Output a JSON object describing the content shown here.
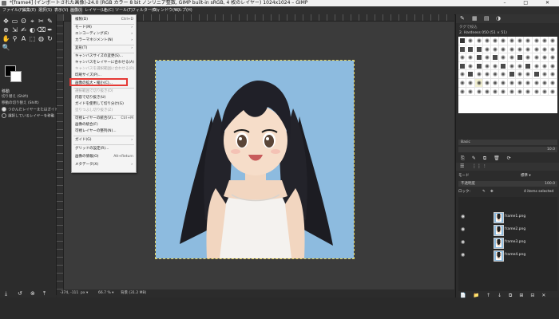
{
  "window": {
    "title": "*[frame4] (インポートされた画像)-24.0 (RGB カラー 8 bit ノンリニア整数, GIMP built-in sRGB, 4 枚のレイヤー) 1024x1024 – GIMP",
    "controls": "– □ ✕"
  },
  "menubar": {
    "items": [
      "ファイル(F)",
      "編集(E)",
      "選択(S)",
      "表示(V)",
      "画像(I)",
      "レイヤー(L)",
      "色(C)",
      "ツール(T)",
      "フィルター(R)",
      "ウィンドウ(W)",
      "ヘルプ(H)"
    ]
  },
  "image_menu": {
    "items": [
      {
        "label": "複製(D)",
        "shortcut": "Ctrl+D"
      },
      {
        "label": "モード(M)",
        "arrow": "›"
      },
      {
        "label": "エンコーディング(E)",
        "arrow": "›"
      },
      {
        "label": "カラーマネジメント(N)",
        "arrow": "›"
      },
      {
        "label": "変形(T)",
        "arrow": "›"
      },
      {
        "label": "キャンバスサイズの変更(S)..."
      },
      {
        "label": "キャンバスをレイヤーに合わせる(A)"
      },
      {
        "label": "キャンバスを選択範囲に合わせる(R)",
        "disabled": true
      },
      {
        "label": "印刷サイズ(P)..."
      },
      {
        "label": "画像の拡大・縮小(C)..."
      },
      {
        "label": "選択範囲で切り抜き(O)",
        "disabled": true
      },
      {
        "label": "内容で切り抜き(U)"
      },
      {
        "label": "ガイドを使用して切り分け(G)"
      },
      {
        "label": "塗りつぶし切り抜き(Z)",
        "disabled": true
      },
      {
        "label": "可視レイヤーの統合(V)...",
        "shortcut": "Ctrl+M"
      },
      {
        "label": "画像の統合(F)"
      },
      {
        "label": "可視レイヤーの整列(N)..."
      },
      {
        "label": "ガイド(G)",
        "arrow": "›"
      },
      {
        "label": "グリッドの設定(R)..."
      },
      {
        "label": "画像の情報(O)",
        "shortcut": "Alt+Return"
      },
      {
        "label": "メタデータ(X)",
        "arrow": "›"
      }
    ]
  },
  "toolbox": {
    "tools": [
      "✥",
      "▭",
      "ʘ",
      "⌖",
      "✂",
      "✎",
      "⊕",
      "⇲",
      "✍",
      "◐",
      "⌫",
      "✒",
      "✋",
      "⚲",
      "A",
      "⬚",
      "◍",
      "↻",
      "🔍"
    ],
    "options_title": "移動",
    "options_text": "切り替え (Shift)",
    "option_label": "移動の切り替え (Shift)",
    "option1": "つかんだレイヤーまたはガイドを移動",
    "option2": "選択しているレイヤーを移動",
    "bottom_icons": [
      "⤓",
      "↺",
      "⊗",
      "⤒"
    ]
  },
  "status": {
    "coords": "-374, -111",
    "unit": "px ▾",
    "zoom": "66.7 % ▾",
    "info": "背景 (31.2 MB)"
  },
  "right_panel": {
    "tab_icons": [
      "✎",
      "▦",
      "▤",
      "◑"
    ],
    "brush_header": "タグで絞込",
    "brush_name": "2. Hardness 050 (51 × 51)",
    "tag_placeholder": "Basic",
    "spacing_value": "10.0",
    "brush_action_icons": [
      "⎘",
      "✎",
      "⧉",
      "🗑",
      "⟳"
    ],
    "layers_tab_icons": [
      "☰",
      "⋮⋮",
      "⫶"
    ],
    "mode_label": "モード",
    "mode_value": "標準 ▾",
    "opacity_label": "不透明度",
    "opacity_value": "100.0",
    "lock_label": "ロック:",
    "selected_info": "4 items selected",
    "layers": [
      {
        "name": "frame1.png"
      },
      {
        "name": "frame2.png"
      },
      {
        "name": "frame3.png"
      },
      {
        "name": "frame4.png"
      }
    ],
    "layer_action_icons": [
      "📄",
      "📁",
      "↑",
      "↓",
      "⧉",
      "⊞",
      "⊟",
      "✕"
    ]
  }
}
